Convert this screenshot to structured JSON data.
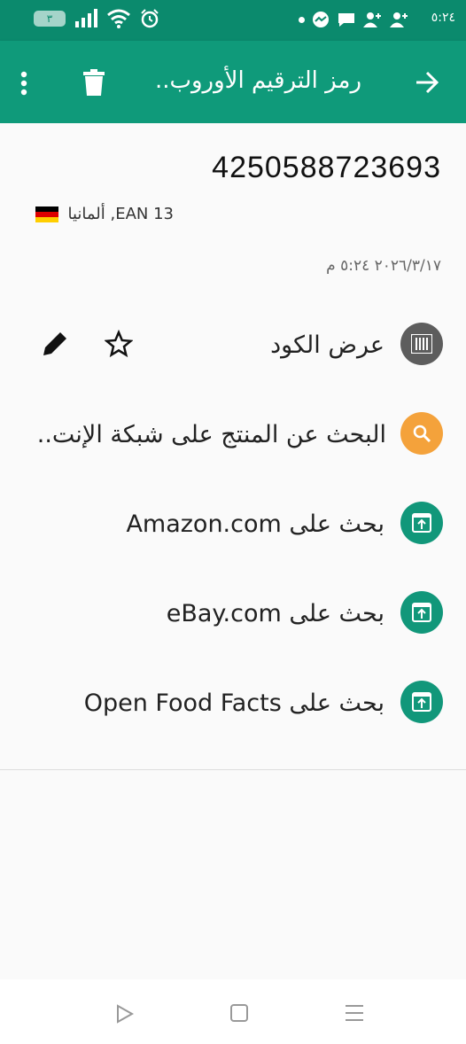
{
  "status": {
    "time": "٥:٢٤",
    "battery": "٣"
  },
  "appbar": {
    "title": "رمز الترقيم الأوروب.."
  },
  "code": {
    "number": "4250588723693",
    "type_country": "ألمانيا ,EAN 13",
    "date": "٢٠٢٦/٣/١٧ ٥:٢٤ م"
  },
  "actions": [
    {
      "label": "عرض الكود",
      "icon": "barcode-icon",
      "color": "#5d5d5d"
    },
    {
      "label": "البحث عن المنتج على شبكة الإنت..",
      "icon": "search-icon",
      "color": "#f4a23b"
    },
    {
      "label": "بحث على Amazon.com",
      "icon": "open-in-icon",
      "color": "#11977a"
    },
    {
      "label": "بحث على eBay.com",
      "icon": "open-in-icon",
      "color": "#11977a"
    },
    {
      "label": "بحث على Open Food Facts",
      "icon": "open-in-icon",
      "color": "#11977a"
    }
  ],
  "colors": {
    "primary": "#0f9a7a",
    "statusbar": "#0b8a6d"
  }
}
